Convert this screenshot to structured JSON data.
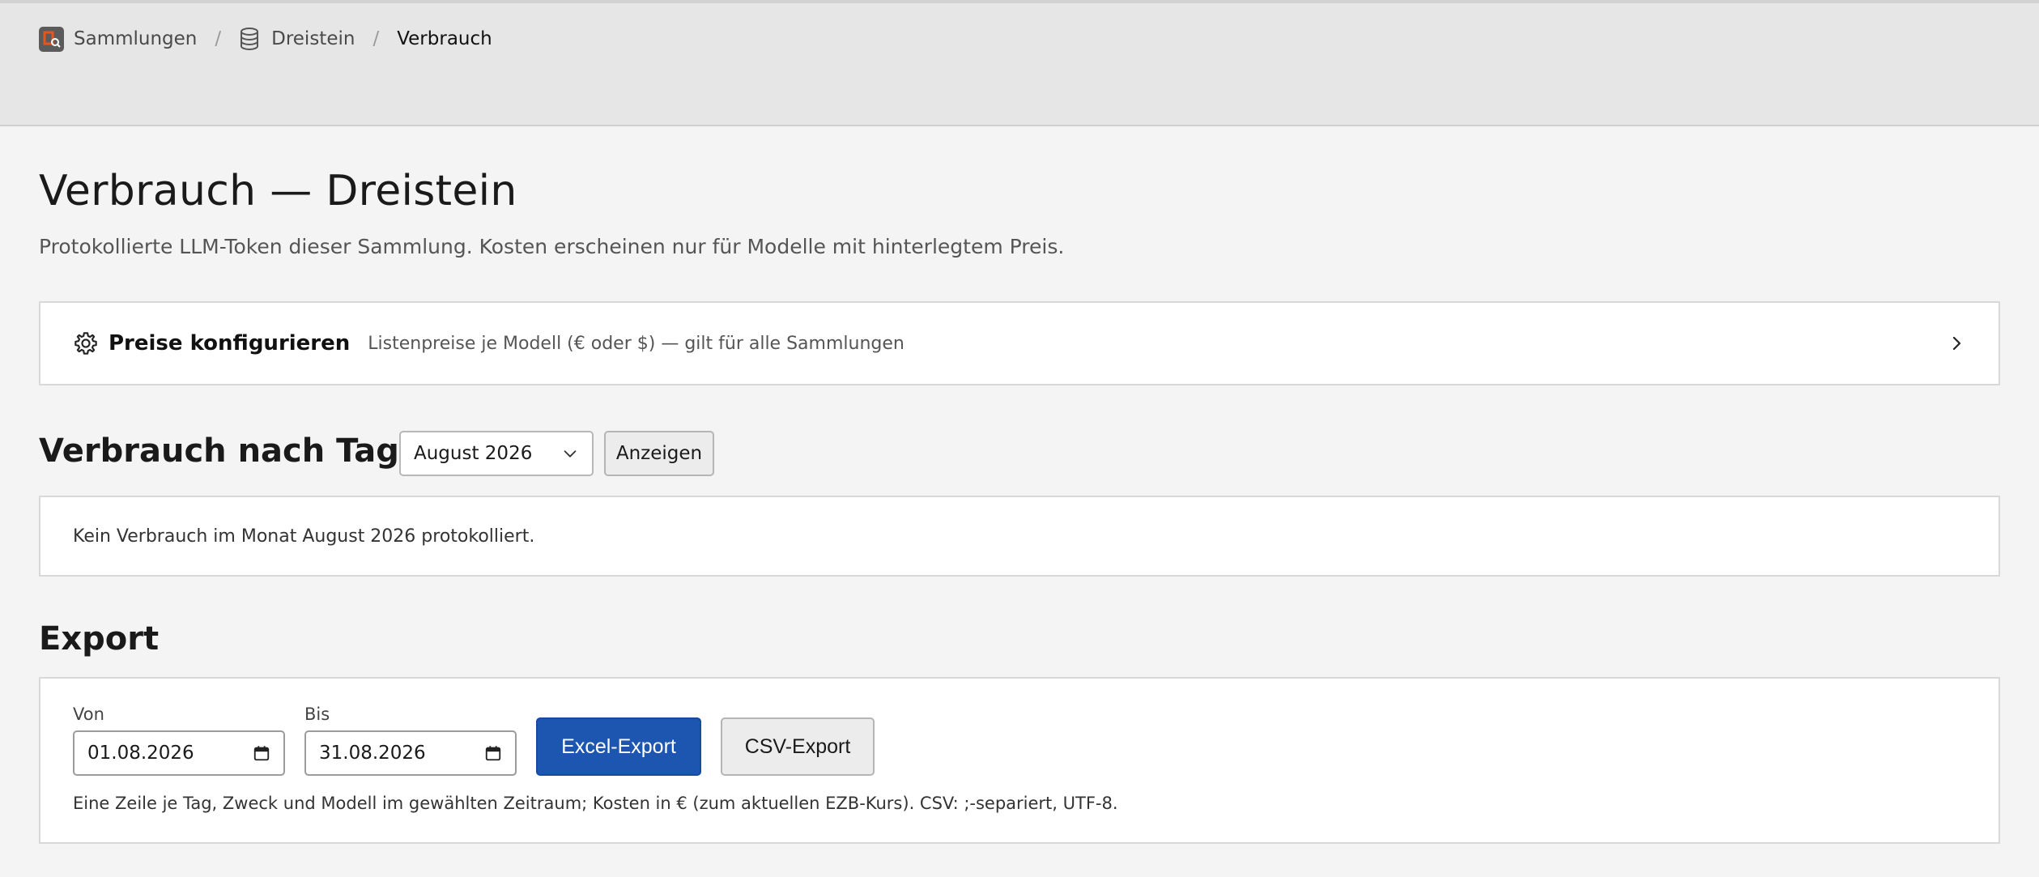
{
  "breadcrumb": {
    "items": [
      {
        "label": "Sammlungen",
        "icon": "app-logo-icon"
      },
      {
        "label": "Dreistein",
        "icon": "database-icon"
      },
      {
        "label": "Verbrauch"
      }
    ],
    "separator": "/"
  },
  "page": {
    "title": "Verbrauch — Dreistein",
    "subtitle": "Protokollierte LLM-Token dieser Sammlung. Kosten erscheinen nur für Modelle mit hinterlegtem Preis."
  },
  "prices": {
    "title": "Preise konfigurieren",
    "description": "Listenpreise je Modell (€ oder $) — gilt für alle Sammlungen",
    "icon": "gear-icon"
  },
  "usage": {
    "heading": "Verbrauch nach Tag",
    "month_selected": "August 2026",
    "show_label": "Anzeigen",
    "empty_text": "Kein Verbrauch im Monat August 2026 protokolliert."
  },
  "export": {
    "heading": "Export",
    "from_label": "Von",
    "from_value": "01.08.2026",
    "to_label": "Bis",
    "to_value": "31.08.2026",
    "excel_label": "Excel-Export",
    "csv_label": "CSV-Export",
    "hint": "Eine Zeile je Tag, Zweck und Modell im gewählten Zeitraum; Kosten in € (zum aktuellen EZB-Kurs). CSV: ;-separiert, UTF-8."
  },
  "colors": {
    "primary_button": "#1d56b1",
    "logo_accent": "#e8541c",
    "header_bg": "#e6e6e6",
    "page_bg": "#f4f4f4"
  }
}
